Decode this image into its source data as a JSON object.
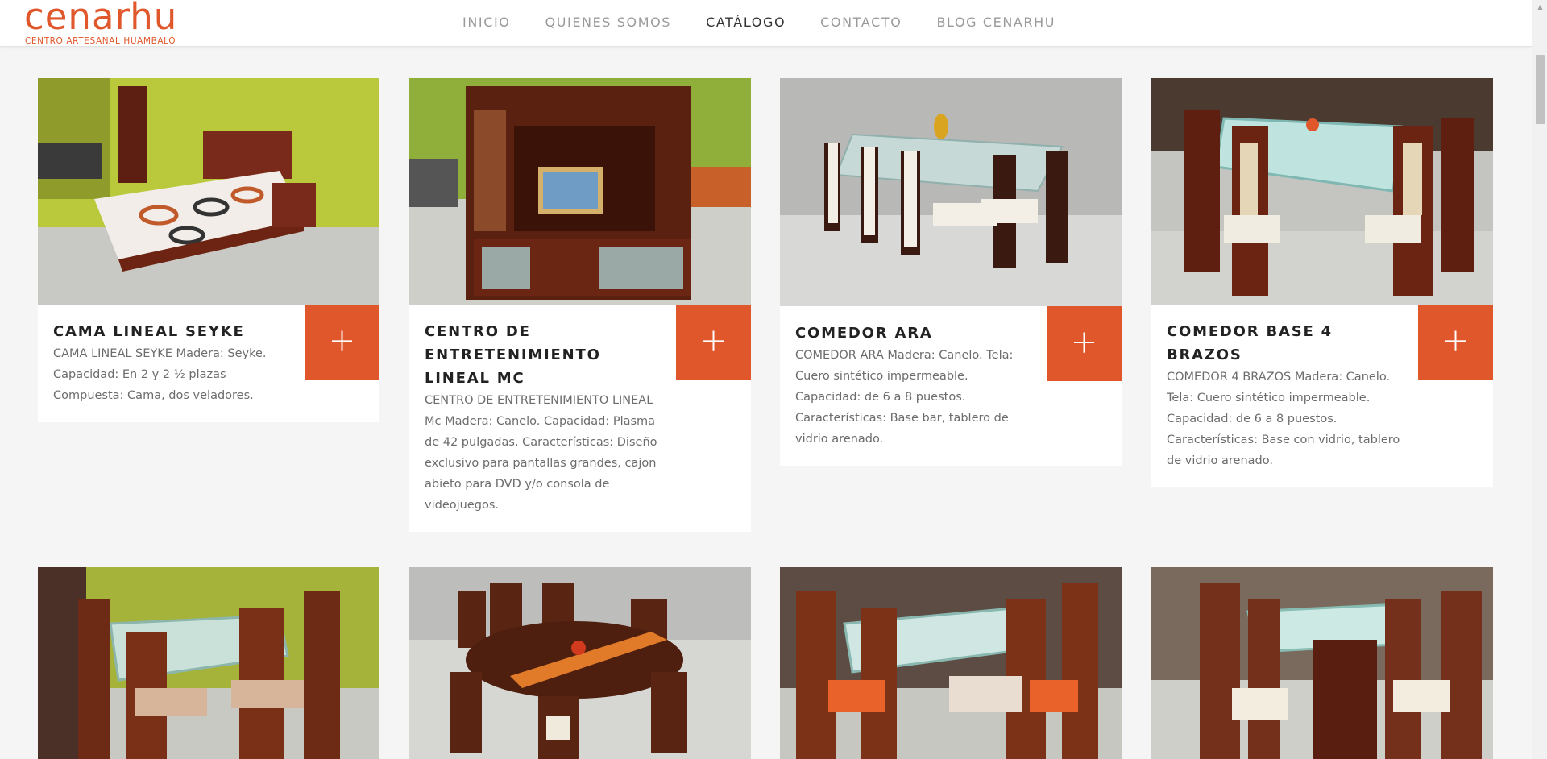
{
  "header": {
    "logo_text": "cenarhu",
    "logo_tagline": "CENTRO ARTESANAL HUAMBALÓ",
    "nav": [
      {
        "label": "INICIO",
        "active": false
      },
      {
        "label": "QUIENES SOMOS",
        "active": false
      },
      {
        "label": "CATÁLOGO",
        "active": true
      },
      {
        "label": "CONTACTO",
        "active": false
      },
      {
        "label": "BLOG CENARHU",
        "active": false
      }
    ]
  },
  "colors": {
    "accent": "#e0572b",
    "page_bg": "#f5f5f5",
    "nav_text": "#9a9a9a",
    "nav_active": "#333333"
  },
  "plus_symbol": "+",
  "products": [
    {
      "title": "CAMA LINEAL SEYKE",
      "description": "CAMA LINEAL SEYKE Madera: Seyke. Capacidad: En 2 y 2 ½ plazas Compuesta: Cama, dos veladores.",
      "photo_subject": "bed"
    },
    {
      "title": "CENTRO DE ENTRETENIMIENTO LINEAL MC",
      "description": "CENTRO DE ENTRETENIMIENTO LINEAL Mc   Madera: Canelo. Capacidad: Plasma de 42 pulgadas. Características: Diseño exclusivo para pantallas grandes, cajon abieto para DVD y/o consola de videojuegos.",
      "photo_subject": "entertainment-center"
    },
    {
      "title": "COMEDOR ARA",
      "description": "COMEDOR ARA Madera: Canelo. Tela: Cuero sintético impermeable. Capacidad: de 6 a 8 puestos. Características: Base bar, tablero de vidrio arenado.",
      "photo_subject": "dining-set-white"
    },
    {
      "title": "COMEDOR BASE 4 BRAZOS",
      "description": "COMEDOR 4 BRAZOS Madera: Canelo. Tela: Cuero sintético impermeable. Capacidad: de 6 a 8 puestos. Características: Base con vidrio, tablero de vidrio arenado.",
      "photo_subject": "dining-set-glass"
    },
    {
      "title": "",
      "description": "",
      "photo_subject": "dining-set-beige"
    },
    {
      "title": "",
      "description": "",
      "photo_subject": "dining-set-oval"
    },
    {
      "title": "",
      "description": "",
      "photo_subject": "dining-set-orange"
    },
    {
      "title": "",
      "description": "",
      "photo_subject": "dining-set-cream"
    }
  ]
}
